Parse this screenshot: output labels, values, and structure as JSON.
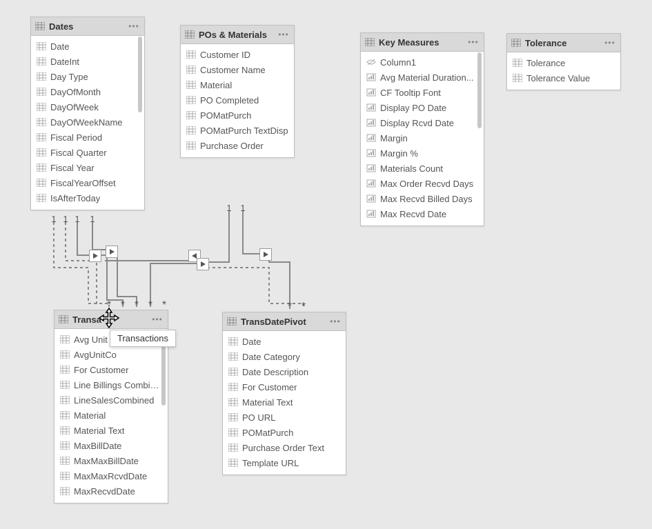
{
  "tables": {
    "dates": {
      "title": "Dates",
      "fields": [
        "Date",
        "DateInt",
        "Day Type",
        "DayOfMonth",
        "DayOfWeek",
        "DayOfWeekName",
        "Fiscal Period",
        "Fiscal Quarter",
        "Fiscal Year",
        "FiscalYearOffset",
        "IsAfterToday"
      ]
    },
    "pos": {
      "title": "POs & Materials",
      "fields": [
        "Customer ID",
        "Customer Name",
        "Material",
        "PO Completed",
        "POMatPurch",
        "POMatPurch TextDisp",
        "Purchase Order"
      ]
    },
    "key": {
      "title": "Key Measures",
      "fields": [
        "Column1",
        "Avg Material Duration...",
        "CF Tooltip Font",
        "Display PO Date",
        "Display Rcvd Date",
        "Margin",
        "Margin %",
        "Materials Count",
        "Max Order Recvd Days",
        "Max Recvd Billed Days",
        "Max Recvd Date"
      ]
    },
    "tol": {
      "title": "Tolerance",
      "fields": [
        "Tolerance",
        "Tolerance Value"
      ]
    },
    "trans": {
      "title": "Transact",
      "cut_title": "Transa",
      "tooltip": "Transactions",
      "fields": [
        "Avg Unit P",
        "AvgUnitCo",
        "For Customer",
        "Line Billings Combined",
        "LineSalesCombined",
        "Material",
        "Material Text",
        "MaxBillDate",
        "MaxMaxBillDate",
        "MaxMaxRcvdDate",
        "MaxRecvdDate"
      ]
    },
    "pivot": {
      "title": "TransDatePivot",
      "fields": [
        "Date",
        "Date Category",
        "Date Description",
        "For Customer",
        "Material Text",
        "PO URL",
        "POMatPurch",
        "Purchase Order Text",
        "Template URL"
      ]
    }
  },
  "cardinality": {
    "one": "1",
    "many": "*"
  }
}
